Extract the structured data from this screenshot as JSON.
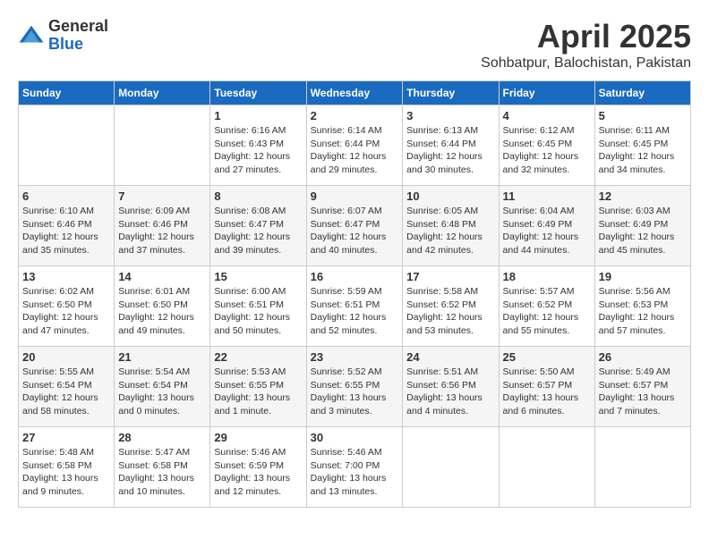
{
  "header": {
    "logo_general": "General",
    "logo_blue": "Blue",
    "title": "April 2025",
    "subtitle": "Sohbatpur, Balochistan, Pakistan"
  },
  "weekdays": [
    "Sunday",
    "Monday",
    "Tuesday",
    "Wednesday",
    "Thursday",
    "Friday",
    "Saturday"
  ],
  "weeks": [
    [
      {
        "day": "",
        "sunrise": "",
        "sunset": "",
        "daylight": ""
      },
      {
        "day": "",
        "sunrise": "",
        "sunset": "",
        "daylight": ""
      },
      {
        "day": "1",
        "sunrise": "Sunrise: 6:16 AM",
        "sunset": "Sunset: 6:43 PM",
        "daylight": "Daylight: 12 hours and 27 minutes."
      },
      {
        "day": "2",
        "sunrise": "Sunrise: 6:14 AM",
        "sunset": "Sunset: 6:44 PM",
        "daylight": "Daylight: 12 hours and 29 minutes."
      },
      {
        "day": "3",
        "sunrise": "Sunrise: 6:13 AM",
        "sunset": "Sunset: 6:44 PM",
        "daylight": "Daylight: 12 hours and 30 minutes."
      },
      {
        "day": "4",
        "sunrise": "Sunrise: 6:12 AM",
        "sunset": "Sunset: 6:45 PM",
        "daylight": "Daylight: 12 hours and 32 minutes."
      },
      {
        "day": "5",
        "sunrise": "Sunrise: 6:11 AM",
        "sunset": "Sunset: 6:45 PM",
        "daylight": "Daylight: 12 hours and 34 minutes."
      }
    ],
    [
      {
        "day": "6",
        "sunrise": "Sunrise: 6:10 AM",
        "sunset": "Sunset: 6:46 PM",
        "daylight": "Daylight: 12 hours and 35 minutes."
      },
      {
        "day": "7",
        "sunrise": "Sunrise: 6:09 AM",
        "sunset": "Sunset: 6:46 PM",
        "daylight": "Daylight: 12 hours and 37 minutes."
      },
      {
        "day": "8",
        "sunrise": "Sunrise: 6:08 AM",
        "sunset": "Sunset: 6:47 PM",
        "daylight": "Daylight: 12 hours and 39 minutes."
      },
      {
        "day": "9",
        "sunrise": "Sunrise: 6:07 AM",
        "sunset": "Sunset: 6:47 PM",
        "daylight": "Daylight: 12 hours and 40 minutes."
      },
      {
        "day": "10",
        "sunrise": "Sunrise: 6:05 AM",
        "sunset": "Sunset: 6:48 PM",
        "daylight": "Daylight: 12 hours and 42 minutes."
      },
      {
        "day": "11",
        "sunrise": "Sunrise: 6:04 AM",
        "sunset": "Sunset: 6:49 PM",
        "daylight": "Daylight: 12 hours and 44 minutes."
      },
      {
        "day": "12",
        "sunrise": "Sunrise: 6:03 AM",
        "sunset": "Sunset: 6:49 PM",
        "daylight": "Daylight: 12 hours and 45 minutes."
      }
    ],
    [
      {
        "day": "13",
        "sunrise": "Sunrise: 6:02 AM",
        "sunset": "Sunset: 6:50 PM",
        "daylight": "Daylight: 12 hours and 47 minutes."
      },
      {
        "day": "14",
        "sunrise": "Sunrise: 6:01 AM",
        "sunset": "Sunset: 6:50 PM",
        "daylight": "Daylight: 12 hours and 49 minutes."
      },
      {
        "day": "15",
        "sunrise": "Sunrise: 6:00 AM",
        "sunset": "Sunset: 6:51 PM",
        "daylight": "Daylight: 12 hours and 50 minutes."
      },
      {
        "day": "16",
        "sunrise": "Sunrise: 5:59 AM",
        "sunset": "Sunset: 6:51 PM",
        "daylight": "Daylight: 12 hours and 52 minutes."
      },
      {
        "day": "17",
        "sunrise": "Sunrise: 5:58 AM",
        "sunset": "Sunset: 6:52 PM",
        "daylight": "Daylight: 12 hours and 53 minutes."
      },
      {
        "day": "18",
        "sunrise": "Sunrise: 5:57 AM",
        "sunset": "Sunset: 6:52 PM",
        "daylight": "Daylight: 12 hours and 55 minutes."
      },
      {
        "day": "19",
        "sunrise": "Sunrise: 5:56 AM",
        "sunset": "Sunset: 6:53 PM",
        "daylight": "Daylight: 12 hours and 57 minutes."
      }
    ],
    [
      {
        "day": "20",
        "sunrise": "Sunrise: 5:55 AM",
        "sunset": "Sunset: 6:54 PM",
        "daylight": "Daylight: 12 hours and 58 minutes."
      },
      {
        "day": "21",
        "sunrise": "Sunrise: 5:54 AM",
        "sunset": "Sunset: 6:54 PM",
        "daylight": "Daylight: 13 hours and 0 minutes."
      },
      {
        "day": "22",
        "sunrise": "Sunrise: 5:53 AM",
        "sunset": "Sunset: 6:55 PM",
        "daylight": "Daylight: 13 hours and 1 minute."
      },
      {
        "day": "23",
        "sunrise": "Sunrise: 5:52 AM",
        "sunset": "Sunset: 6:55 PM",
        "daylight": "Daylight: 13 hours and 3 minutes."
      },
      {
        "day": "24",
        "sunrise": "Sunrise: 5:51 AM",
        "sunset": "Sunset: 6:56 PM",
        "daylight": "Daylight: 13 hours and 4 minutes."
      },
      {
        "day": "25",
        "sunrise": "Sunrise: 5:50 AM",
        "sunset": "Sunset: 6:57 PM",
        "daylight": "Daylight: 13 hours and 6 minutes."
      },
      {
        "day": "26",
        "sunrise": "Sunrise: 5:49 AM",
        "sunset": "Sunset: 6:57 PM",
        "daylight": "Daylight: 13 hours and 7 minutes."
      }
    ],
    [
      {
        "day": "27",
        "sunrise": "Sunrise: 5:48 AM",
        "sunset": "Sunset: 6:58 PM",
        "daylight": "Daylight: 13 hours and 9 minutes."
      },
      {
        "day": "28",
        "sunrise": "Sunrise: 5:47 AM",
        "sunset": "Sunset: 6:58 PM",
        "daylight": "Daylight: 13 hours and 10 minutes."
      },
      {
        "day": "29",
        "sunrise": "Sunrise: 5:46 AM",
        "sunset": "Sunset: 6:59 PM",
        "daylight": "Daylight: 13 hours and 12 minutes."
      },
      {
        "day": "30",
        "sunrise": "Sunrise: 5:46 AM",
        "sunset": "Sunset: 7:00 PM",
        "daylight": "Daylight: 13 hours and 13 minutes."
      },
      {
        "day": "",
        "sunrise": "",
        "sunset": "",
        "daylight": ""
      },
      {
        "day": "",
        "sunrise": "",
        "sunset": "",
        "daylight": ""
      },
      {
        "day": "",
        "sunrise": "",
        "sunset": "",
        "daylight": ""
      }
    ]
  ]
}
